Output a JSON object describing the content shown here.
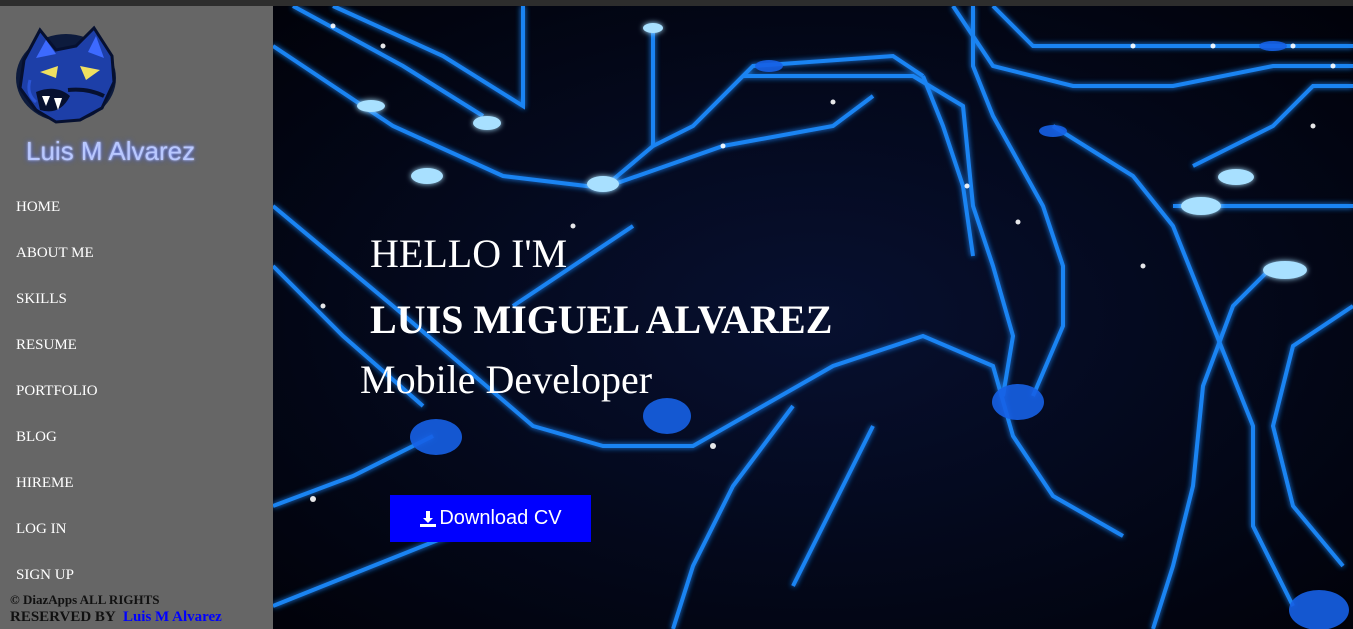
{
  "brand": {
    "name": "Luis M Alvarez",
    "logo_icon": "panther-logo-icon"
  },
  "nav": {
    "items": [
      {
        "label": "HOME"
      },
      {
        "label": "ABOUT ME"
      },
      {
        "label": "SKILLS"
      },
      {
        "label": "RESUME"
      },
      {
        "label": "PORTFOLIO"
      },
      {
        "label": "BLOG"
      },
      {
        "label": "HIREME"
      },
      {
        "label": "LOG IN"
      },
      {
        "label": "SIGN UP"
      }
    ]
  },
  "footer": {
    "line1": "© DiazApps ALL RIGHTS",
    "line2_prefix": "RESERVED BY",
    "link": "Luis M Alvarez"
  },
  "hero": {
    "greeting": "HELLO I'M",
    "name": "LUIS MIGUEL ALVAREZ",
    "role": "Mobile Developer",
    "cta_label": "Download CV",
    "cta_icon": "download-icon"
  },
  "colors": {
    "sidebar": "#666666",
    "hero_bg": "#03050f",
    "accent": "#0000ff",
    "circuit": "#1e8bff"
  }
}
